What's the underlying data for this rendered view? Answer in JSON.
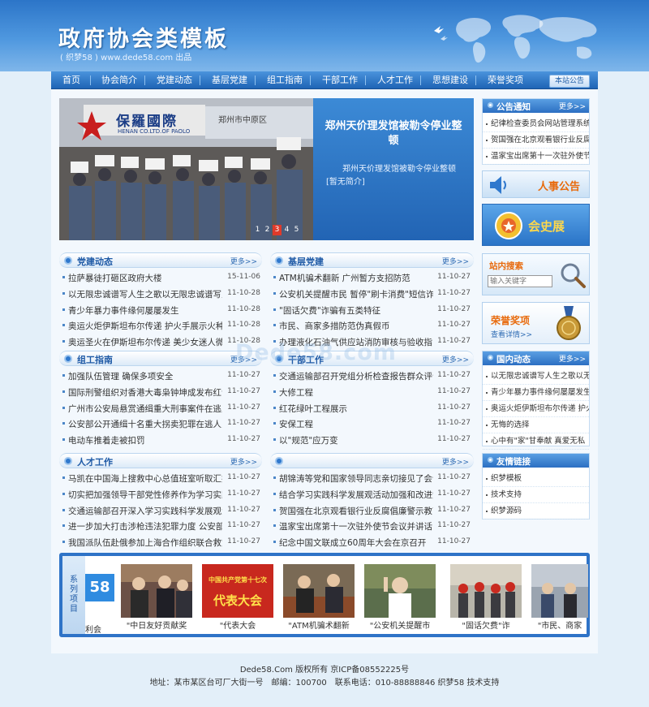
{
  "header": {
    "title": "政府协会类模板",
    "subtitle": "( 织梦58 ) www.dede58.com 出品"
  },
  "nav": {
    "items": [
      "首页",
      "协会简介",
      "党建动态",
      "基层党建",
      "组工指南",
      "干部工作",
      "人才工作",
      "思想建设",
      "荣誉奖项"
    ],
    "notice_tab": "本站公告"
  },
  "slider": {
    "headline": "郑州天价理发馆被勒令停业整顿",
    "summary": "郑州天价理发馆被勒令停业整顿[暂无简介]",
    "photo_sign_1": "保羅國際",
    "photo_sign_2": "HENAN CO.LTD.OF PAOLO",
    "photo_sign_3": "郑州市中原区",
    "pages": [
      "1",
      "2",
      "3",
      "4",
      "5"
    ],
    "active_page": 3
  },
  "sections": {
    "dangjian": {
      "title": "党建动态",
      "more": "更多>>",
      "items": [
        {
          "t": "拉萨暴徒打砸区政府大楼",
          "d": "15-11-06"
        },
        {
          "t": "以无限忠诚谱写人生之歌以无限忠诚谱写人生",
          "d": "11-10-28"
        },
        {
          "t": "青少年暴力事件缘何屡屡发生",
          "d": "11-10-28"
        },
        {
          "t": "奥运火炬伊斯坦布尔传递 护火手展示火种灯",
          "d": "11-10-28"
        },
        {
          "t": "奥运圣火在伊斯坦布尔传递 美少女迷人微笑",
          "d": "11-10-28"
        }
      ]
    },
    "jiceng": {
      "title": "基层党建",
      "more": "更多>>",
      "items": [
        {
          "t": "ATM机骗术翻新 广州暂方支招防范",
          "d": "11-10-27"
        },
        {
          "t": "公安机关提醒市民 暂停\"刷卡消费\"短信诈",
          "d": "11-10-27"
        },
        {
          "t": "\"固话欠费\"诈骗有五类特征",
          "d": "11-10-27"
        },
        {
          "t": "市民、商家多措防范伪真假币",
          "d": "11-10-27"
        },
        {
          "t": "办理液化石油气供应站消防审核与验收指引",
          "d": "11-10-27"
        }
      ]
    },
    "zugong": {
      "title": "组工指南",
      "more": "更多>>",
      "items": [
        {
          "t": "加强队伍管理 确保多项安全",
          "d": "11-10-27"
        },
        {
          "t": "国际刑警组织对香港大毒枭钟坤成发布红色通",
          "d": "11-10-27"
        },
        {
          "t": "广州市公安局悬赏通缉重大刑事案件在逃人员",
          "d": "11-10-27"
        },
        {
          "t": "公安部公开通缉十名重大拐卖犯罪在逃人员",
          "d": "11-10-27"
        },
        {
          "t": "电动车推着走被扣罚",
          "d": "11-10-27"
        }
      ]
    },
    "ganbu": {
      "title": "干部工作",
      "more": "更多>>",
      "items": [
        {
          "t": "交通运输部召开党组分析检查报告群众评议大",
          "d": "11-10-27"
        },
        {
          "t": "大修工程",
          "d": "11-10-27"
        },
        {
          "t": "红花绿叶工程展示",
          "d": "11-10-27"
        },
        {
          "t": "安保工程",
          "d": "11-10-27"
        },
        {
          "t": "以\"规范\"应万变",
          "d": "11-10-27"
        }
      ]
    },
    "rencai": {
      "title": "人才工作",
      "more": "更多>>",
      "items": [
        {
          "t": "马凯在中国海上搜救中心总值班室听取汇报",
          "d": "11-10-27"
        },
        {
          "t": "切实把加强领导干部党性修养作为学习实践活",
          "d": "11-10-27"
        },
        {
          "t": "交通运输部召开深入学习实践科学发展观活动",
          "d": "11-10-27"
        },
        {
          "t": "进一步加大打击涉枪违法犯罪力度 公安部挂",
          "d": "11-10-27"
        },
        {
          "t": "我国派队伍赴俄参加上海合作组织联合救灾演",
          "d": "11-10-27"
        }
      ]
    },
    "sixiang": {
      "title": "",
      "more": "更多>>",
      "items": [
        {
          "t": "胡锦涛等党和国家领导同志亲切接见了会议代",
          "d": "11-10-27"
        },
        {
          "t": "结合学习实践科学发展观活动加强和改进党的",
          "d": "11-10-27"
        },
        {
          "t": "贺国强在北京观看银行业反腐倡廉警示教育展",
          "d": "11-10-27"
        },
        {
          "t": "温家宝出席第十一次驻外使节会议并讲话",
          "d": "11-10-27"
        },
        {
          "t": "纪念中国文联成立60周年大会在京召开",
          "d": "11-10-27"
        }
      ]
    }
  },
  "right": {
    "notice": {
      "title": "公告通知",
      "more": "更多>>",
      "items": [
        "纪律检查委员会网站管理系统...",
        "贺国强在北京观看银行业反腐...",
        "温家宝出席第十一次驻外使节..."
      ]
    },
    "hr_banner": "人事公告",
    "history_banner": "会史展",
    "search": {
      "title": "站内搜索",
      "placeholder": "输入关键字"
    },
    "honor": {
      "title": "荣誉奖项",
      "link": "查看详情>>"
    },
    "domestic": {
      "title": "国内动态",
      "more": "更多>>",
      "items": [
        "以无限忠诚谱写人生之歌以无限",
        "青少年暴力事件缘何屡屡发生",
        "奥运火炬伊斯坦布尔传递 护火",
        "无悔的选择",
        "心中有\"家\"甘奉献 真爱无私"
      ]
    },
    "links": {
      "title": "友情链接",
      "items": [
        "织梦模板",
        "技术支持",
        "织梦源码"
      ]
    }
  },
  "gallery": {
    "label": "系列项目",
    "badge": "58",
    "items": [
      "\"中日友好贡献奖",
      "\"代表大会",
      "\"ATM机骗术翻新",
      "\"公安机关提醒市",
      "\"固话欠费\"诈",
      "\"市民、商家"
    ],
    "partial_caption": "利会",
    "poster_text_1": "中国共产党第十七次",
    "poster_text_2": "代表大会"
  },
  "footer": {
    "line1": "Dede58.Com 版权所有 京ICP备08552225号",
    "line2": "地址：某市某区台可厂大街一号　邮编：100700　联系电话：010-88888846 织梦58 技术支持"
  },
  "watermark": "Dede58.com",
  "colors": {
    "brand_blue": "#2c75c8",
    "accent_red": "#e03a2a"
  }
}
